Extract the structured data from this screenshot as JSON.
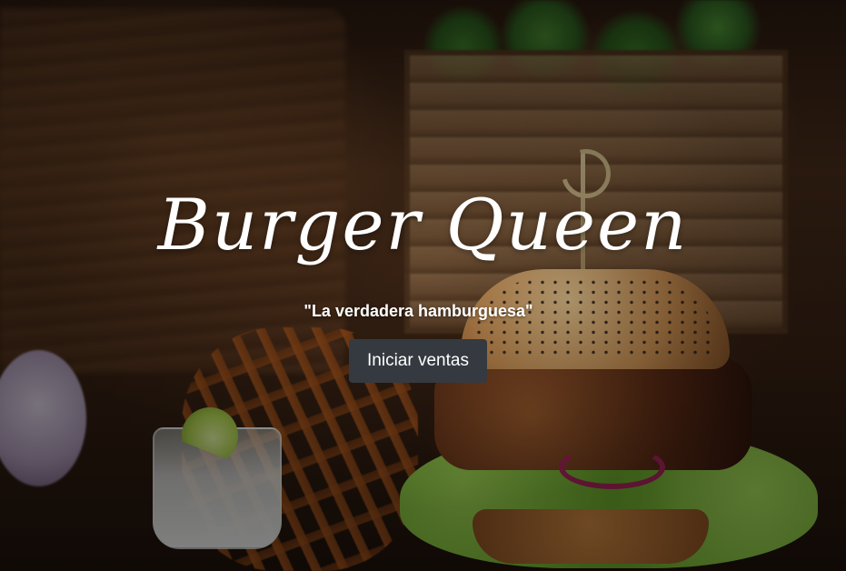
{
  "hero": {
    "title": "Burger Queen",
    "tagline": "\"La verdadera hamburguesa\"",
    "start_button_label": "Iniciar ventas"
  },
  "colors": {
    "button_background": "#343a40",
    "text": "#ffffff"
  }
}
